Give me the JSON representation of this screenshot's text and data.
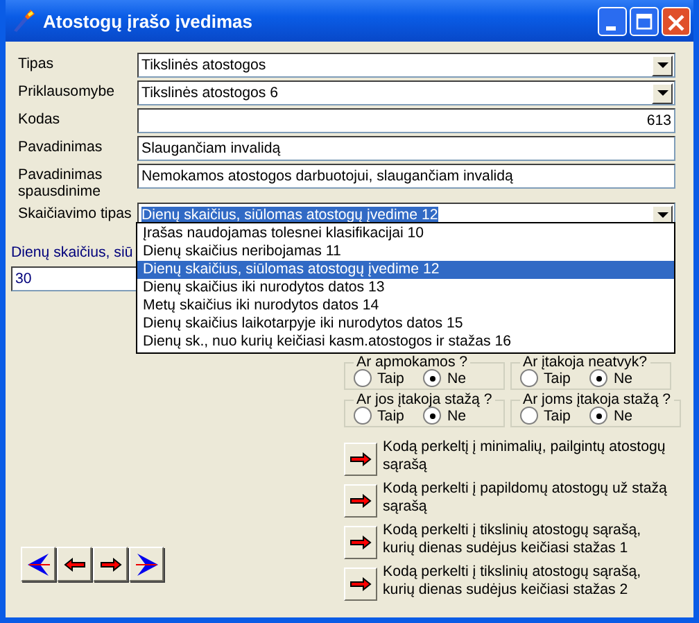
{
  "window": {
    "title": "Atostogų įrašo įvedimas"
  },
  "fields": [
    {
      "label": "Tipas",
      "kind": "combo",
      "value": "Tikslinės atostogos",
      "focused": false
    },
    {
      "label": "Priklausomybe",
      "kind": "combo",
      "value": "Tikslinės atostogos 6",
      "focused": false
    },
    {
      "label": "Kodas",
      "kind": "number",
      "value": "613",
      "focused": false
    },
    {
      "label": "Pavadinimas",
      "kind": "text",
      "value": "Slaugančiam invalidą",
      "focused": false
    },
    {
      "label": "Pavadinimas spausdinime",
      "kind": "text",
      "value": "Nemokamos atostogos darbuotojui, slaugančiam invalidą",
      "focused": false
    },
    {
      "label": "Skaičiavimo tipas",
      "kind": "combo",
      "value": "Dienų skaičius, siūlomas atostogų įvedime 12",
      "focused": true
    }
  ],
  "dropdown": {
    "options": [
      {
        "label": "Įrašas naudojamas tolesnei klasifikacijai 10",
        "selected": false
      },
      {
        "label": "Dienų skaičius neribojamas 11",
        "selected": false
      },
      {
        "label": "Dienų skaičius, siūlomas atostogų įvedime 12",
        "selected": true
      },
      {
        "label": "Dienų skaičius iki nurodytos datos 13",
        "selected": false
      },
      {
        "label": "Metų skaičius iki nurodytos datos 14",
        "selected": false
      },
      {
        "label": "Dienų skaičius laikotarpyje iki nurodytos datos 15",
        "selected": false
      },
      {
        "label": "Dienų sk., nuo kurių keičiasi kasm.atostogos ir stažas 16",
        "selected": false
      }
    ]
  },
  "days": {
    "label": "Dienų skaičius, siū",
    "value": "30"
  },
  "groups": [
    {
      "title": "Ar apmokamos ?",
      "options": [
        {
          "label": "Taip",
          "selected": false
        },
        {
          "label": "Ne",
          "selected": true
        }
      ]
    },
    {
      "title": "Ar įtakoja neatvyk?",
      "options": [
        {
          "label": "Taip",
          "selected": false
        },
        {
          "label": "Ne",
          "selected": true
        }
      ]
    },
    {
      "title": "Ar jos įtakoja stažą ?",
      "options": [
        {
          "label": "Taip",
          "selected": false
        },
        {
          "label": "Ne",
          "selected": true
        }
      ]
    },
    {
      "title": "Ar joms  įtakoja stažą ?",
      "options": [
        {
          "label": "Taip",
          "selected": false
        },
        {
          "label": "Ne",
          "selected": true
        }
      ]
    }
  ],
  "actions": [
    {
      "lines": [
        "Kodą perkeltį į minimalių, pailgintų atostogų",
        "sąrašą"
      ]
    },
    {
      "lines": [
        "Kodą perkelti į papildomų atostogų už stažą",
        "sąrašą"
      ]
    },
    {
      "lines": [
        "Kodą perkelti į tikslinių atostogų sąrašą,",
        "kurių dienas sudėjus keičiasi stažas 1"
      ]
    },
    {
      "lines": [
        "Kodą perkelti į tikslinių atostogų sąrašą,",
        "kurių dienas sudėjus keičiasi stažas 2"
      ]
    }
  ],
  "nav": [
    {
      "kind": "first"
    },
    {
      "kind": "prev"
    },
    {
      "kind": "next"
    },
    {
      "kind": "last"
    }
  ]
}
